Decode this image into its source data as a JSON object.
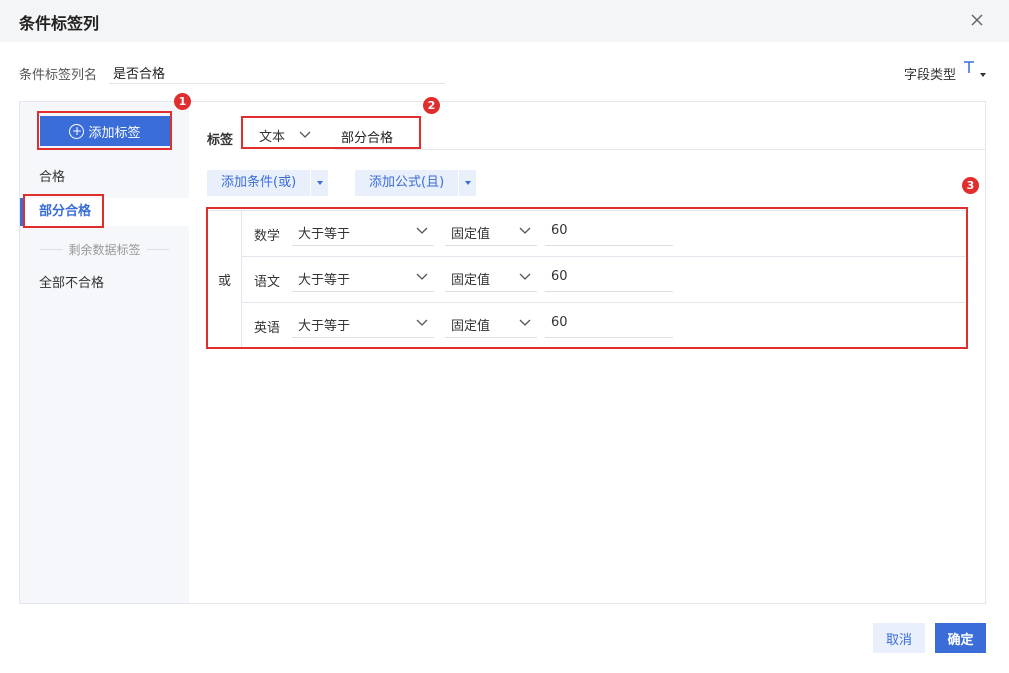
{
  "dialog": {
    "title": "条件标签列"
  },
  "column_name": {
    "label": "条件标签列名",
    "value": "是否合格"
  },
  "field_type": {
    "label": "字段类型",
    "icon": "text-type-icon"
  },
  "sidebar": {
    "add_button": "添加标签",
    "tags": [
      "合格",
      "部分合格"
    ],
    "active_index": 1,
    "remaining_label": "剩余数据标签",
    "remaining_tag": "全部不合格"
  },
  "editor": {
    "tag_label": "标签",
    "value_type": "文本",
    "tag_name": "部分合格",
    "add_condition_or": "添加条件(或)",
    "add_formula_and": "添加公式(且)",
    "logic": "或",
    "conditions": [
      {
        "subject": "数学",
        "operator": "大于等于",
        "value_type": "固定值",
        "value": "60"
      },
      {
        "subject": "语文",
        "operator": "大于等于",
        "value_type": "固定值",
        "value": "60"
      },
      {
        "subject": "英语",
        "operator": "大于等于",
        "value_type": "固定值",
        "value": "60"
      }
    ]
  },
  "annotations": [
    "1",
    "2",
    "3"
  ],
  "footer": {
    "cancel": "取消",
    "confirm": "确定"
  },
  "colors": {
    "accent": "#3a6dd8",
    "annotation": "#e02d2d"
  }
}
